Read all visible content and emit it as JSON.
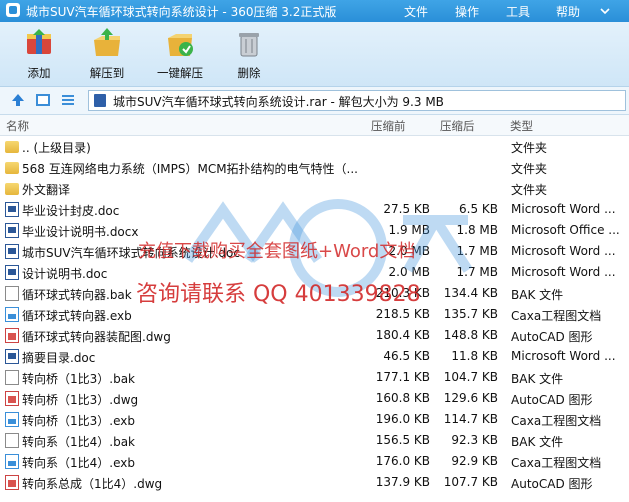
{
  "title": "城市SUV汽车循环球式转向系统设计 - 360压缩 3.2正式版",
  "menu": [
    "文件",
    "操作",
    "工具",
    "帮助"
  ],
  "toolbar": [
    {
      "label": "添加",
      "icon": "add-archive-icon"
    },
    {
      "label": "解压到",
      "icon": "extract-to-icon"
    },
    {
      "label": "一键解压",
      "icon": "one-click-extract-icon"
    },
    {
      "label": "删除",
      "icon": "delete-trash-icon"
    }
  ],
  "address": "城市SUV汽车循环球式转向系统设计.rar - 解包大小为 9.3 MB",
  "columns": [
    "名称",
    "压缩前",
    "压缩后",
    "类型"
  ],
  "files": [
    {
      "name": ".. (上级目录)",
      "before": "",
      "after": "",
      "type": "文件夹",
      "icon": "folder-icon"
    },
    {
      "name": "568 互连网络电力系统（IMPS）MCM拓扑结构的电气特性（...",
      "before": "",
      "after": "",
      "type": "文件夹",
      "icon": "folder-icon"
    },
    {
      "name": "外文翻译",
      "before": "",
      "after": "",
      "type": "文件夹",
      "icon": "folder-icon"
    },
    {
      "name": "毕业设计封皮.doc",
      "before": "27.5 KB",
      "after": "6.5 KB",
      "type": "Microsoft Word ...",
      "icon": "word-doc-icon"
    },
    {
      "name": "毕业设计说明书.docx",
      "before": "1.9 MB",
      "after": "1.8 MB",
      "type": "Microsoft Office ...",
      "icon": "word-doc-icon"
    },
    {
      "name": "城市SUV汽车循环球式转向系统设计.doc",
      "before": "2.0 MB",
      "after": "1.7 MB",
      "type": "Microsoft Word ...",
      "icon": "word-doc-icon"
    },
    {
      "name": "设计说明书.doc",
      "before": "2.0 MB",
      "after": "1.7 MB",
      "type": "Microsoft Word ...",
      "icon": "word-doc-icon"
    },
    {
      "name": "循环球式转向器.bak",
      "before": "210.3 KB",
      "after": "134.4 KB",
      "type": "BAK 文件",
      "icon": "bak-file-icon"
    },
    {
      "name": "循环球式转向器.exb",
      "before": "218.5 KB",
      "after": "135.7 KB",
      "type": "Caxa工程图文档",
      "icon": "caxa-exb-icon"
    },
    {
      "name": "循环球式转向器装配图.dwg",
      "before": "180.4 KB",
      "after": "148.8 KB",
      "type": "AutoCAD 图形",
      "icon": "autocad-dwg-icon"
    },
    {
      "name": "摘要目录.doc",
      "before": "46.5 KB",
      "after": "11.8 KB",
      "type": "Microsoft Word ...",
      "icon": "word-doc-icon"
    },
    {
      "name": "转向桥（1比3）.bak",
      "before": "177.1 KB",
      "after": "104.7 KB",
      "type": "BAK 文件",
      "icon": "bak-file-icon"
    },
    {
      "name": "转向桥（1比3）.dwg",
      "before": "160.8 KB",
      "after": "129.6 KB",
      "type": "AutoCAD 图形",
      "icon": "autocad-dwg-icon"
    },
    {
      "name": "转向桥（1比3）.exb",
      "before": "196.0 KB",
      "after": "114.7 KB",
      "type": "Caxa工程图文档",
      "icon": "caxa-exb-icon"
    },
    {
      "name": "转向系（1比4）.bak",
      "before": "156.5 KB",
      "after": "92.3 KB",
      "type": "BAK 文件",
      "icon": "bak-file-icon"
    },
    {
      "name": "转向系（1比4）.exb",
      "before": "176.0 KB",
      "after": "92.9 KB",
      "type": "Caxa工程图文档",
      "icon": "caxa-exb-icon"
    },
    {
      "name": "转向系总成（1比4）.dwg",
      "before": "137.9 KB",
      "after": "107.7 KB",
      "type": "AutoCAD 图形",
      "icon": "autocad-dwg-icon"
    }
  ],
  "watermark": {
    "line1": "充值下载购买全套图纸+Word文档",
    "line2": "咨询请联系 QQ 401339828"
  }
}
